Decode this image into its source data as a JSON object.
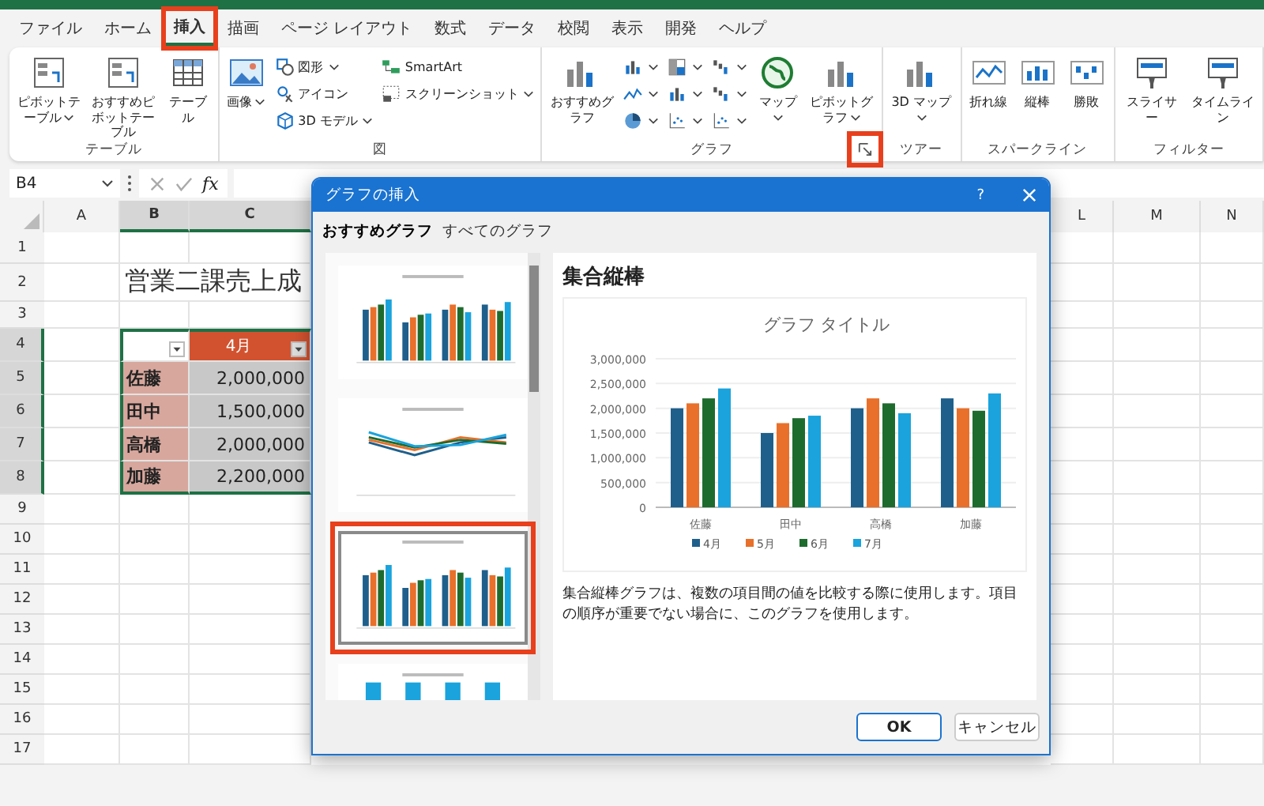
{
  "tabs": [
    {
      "label": "ファイル",
      "selected": false,
      "highlighted": false
    },
    {
      "label": "ホーム",
      "selected": false,
      "highlighted": false
    },
    {
      "label": "挿入",
      "selected": true,
      "highlighted": true
    },
    {
      "label": "描画",
      "selected": false,
      "highlighted": false
    },
    {
      "label": "ページ レイアウト",
      "selected": false,
      "highlighted": false
    },
    {
      "label": "数式",
      "selected": false,
      "highlighted": false
    },
    {
      "label": "データ",
      "selected": false,
      "highlighted": false
    },
    {
      "label": "校閲",
      "selected": false,
      "highlighted": false
    },
    {
      "label": "表示",
      "selected": false,
      "highlighted": false
    },
    {
      "label": "開発",
      "selected": false,
      "highlighted": false
    },
    {
      "label": "ヘルプ",
      "selected": false,
      "highlighted": false
    }
  ],
  "ribbon": {
    "groups": [
      {
        "label": "テーブル",
        "items": [
          {
            "kind": "large",
            "label": "ピボットテーブル",
            "dropdown": true
          },
          {
            "kind": "large",
            "label": "おすすめピボットテーブル",
            "dropdown": false
          },
          {
            "kind": "large",
            "label": "テーブル",
            "dropdown": false
          }
        ]
      },
      {
        "label": "図",
        "items": [
          {
            "kind": "large",
            "label": "画像",
            "dropdown": true
          },
          {
            "kind": "small",
            "label": "図形",
            "dropdown": true
          },
          {
            "kind": "small",
            "label": "アイコン",
            "dropdown": false
          },
          {
            "kind": "small",
            "label": "3D モデル",
            "dropdown": true
          },
          {
            "kind": "small",
            "label": "SmartArt",
            "dropdown": false
          },
          {
            "kind": "small",
            "label": "スクリーンショット",
            "dropdown": true
          }
        ]
      },
      {
        "label": "グラフ",
        "launcher": {
          "highlighted": true
        },
        "items": [
          {
            "kind": "large",
            "label": "おすすめグラフ",
            "dropdown": false
          },
          {
            "kind": "icon",
            "dropdown": true
          },
          {
            "kind": "icon",
            "dropdown": true
          },
          {
            "kind": "icon",
            "dropdown": true
          },
          {
            "kind": "icon",
            "dropdown": true
          },
          {
            "kind": "icon",
            "dropdown": true
          },
          {
            "kind": "icon",
            "dropdown": true
          },
          {
            "kind": "icon",
            "dropdown": true
          },
          {
            "kind": "icon",
            "dropdown": true
          },
          {
            "kind": "icon",
            "dropdown": true
          },
          {
            "kind": "large",
            "label": "マップ",
            "dropdown": true
          },
          {
            "kind": "large",
            "label": "ピボットグラフ",
            "dropdown": true
          }
        ]
      },
      {
        "label": "ツアー",
        "items": [
          {
            "kind": "large",
            "label": "3D マップ",
            "dropdown": true
          }
        ]
      },
      {
        "label": "スパークライン",
        "items": [
          {
            "kind": "large",
            "label": "折れ線",
            "dropdown": false
          },
          {
            "kind": "large",
            "label": "縦棒",
            "dropdown": false
          },
          {
            "kind": "large",
            "label": "勝敗",
            "dropdown": false
          }
        ]
      },
      {
        "label": "フィルター",
        "items": [
          {
            "kind": "large",
            "label": "スライサー",
            "dropdown": false
          },
          {
            "kind": "large",
            "label": "タイムライン",
            "dropdown": false
          }
        ]
      }
    ]
  },
  "formula_bar": {
    "name_box": "B4",
    "function_label": "fx"
  },
  "sheet": {
    "columns": [
      {
        "label": "A",
        "selected": false
      },
      {
        "label": "B",
        "selected": true
      },
      {
        "label": "C",
        "selected": true
      },
      {
        "label": "L",
        "selected": false
      },
      {
        "label": "M",
        "selected": false
      },
      {
        "label": "N",
        "selected": false
      }
    ],
    "rows": [
      {
        "label": "1",
        "selected": false
      },
      {
        "label": "2",
        "selected": false
      },
      {
        "label": "3",
        "selected": false
      },
      {
        "label": "4",
        "selected": true
      },
      {
        "label": "5",
        "selected": true
      },
      {
        "label": "6",
        "selected": true
      },
      {
        "label": "7",
        "selected": true
      },
      {
        "label": "8",
        "selected": true
      },
      {
        "label": "9",
        "selected": false
      },
      {
        "label": "10",
        "selected": false
      },
      {
        "label": "11",
        "selected": false
      },
      {
        "label": "12",
        "selected": false
      },
      {
        "label": "13",
        "selected": false
      },
      {
        "label": "14",
        "selected": false
      },
      {
        "label": "15",
        "selected": false
      },
      {
        "label": "16",
        "selected": false
      },
      {
        "label": "17",
        "selected": false
      }
    ],
    "title": "営業二課売上成",
    "table": {
      "header": "4月",
      "rows": [
        {
          "name": "佐藤",
          "value": "2,000,000"
        },
        {
          "name": "田中",
          "value": "1,500,000"
        },
        {
          "name": "高橋",
          "value": "2,000,000"
        },
        {
          "name": "加藤",
          "value": "2,200,000"
        }
      ]
    }
  },
  "dialog": {
    "title": "グラフの挿入",
    "help": "?",
    "tabs": [
      {
        "label": "おすすめグラフ",
        "selected": true
      },
      {
        "label": "すべてのグラフ",
        "selected": false
      }
    ],
    "thumbnails": [
      {
        "kind": "column",
        "selected": false,
        "highlighted": false
      },
      {
        "kind": "line",
        "selected": false,
        "highlighted": false
      },
      {
        "kind": "column",
        "selected": true,
        "highlighted": true
      },
      {
        "kind": "stacked",
        "selected": false,
        "highlighted": false
      }
    ],
    "chart_name": "集合縦棒",
    "chart_data": {
      "type": "bar",
      "title": "グラフ タイトル",
      "categories": [
        "佐藤",
        "田中",
        "高橋",
        "加藤"
      ],
      "series": [
        {
          "name": "4月",
          "color": "#1f5f8b",
          "values": [
            2000000,
            1500000,
            2000000,
            2200000
          ]
        },
        {
          "name": "5月",
          "color": "#e8702a",
          "values": [
            2100000,
            1700000,
            2200000,
            2000000
          ]
        },
        {
          "name": "6月",
          "color": "#1e6b2e",
          "values": [
            2200000,
            1800000,
            2100000,
            1950000
          ]
        },
        {
          "name": "7月",
          "color": "#1aa3dc",
          "values": [
            2400000,
            1850000,
            1900000,
            2300000
          ]
        }
      ],
      "ylim": [
        0,
        3000000
      ],
      "grid": true,
      "legend": true,
      "yticks": [
        {
          "value": 0,
          "label": "0"
        },
        {
          "value": 500000,
          "label": "500,000"
        },
        {
          "value": 1000000,
          "label": "1,000,000"
        },
        {
          "value": 1500000,
          "label": "1,500,000"
        },
        {
          "value": 2000000,
          "label": "2,000,000"
        },
        {
          "value": 2500000,
          "label": "2,500,000"
        },
        {
          "value": 3000000,
          "label": "3,000,000"
        }
      ]
    },
    "description": "集合縦棒グラフは、複数の項目間の値を比較する際に使用します。項目の順序が重要でない場合に、このグラフを使用します。",
    "buttons": [
      {
        "label": "OK",
        "default": true
      },
      {
        "label": "キャンセル",
        "default": false
      }
    ]
  }
}
